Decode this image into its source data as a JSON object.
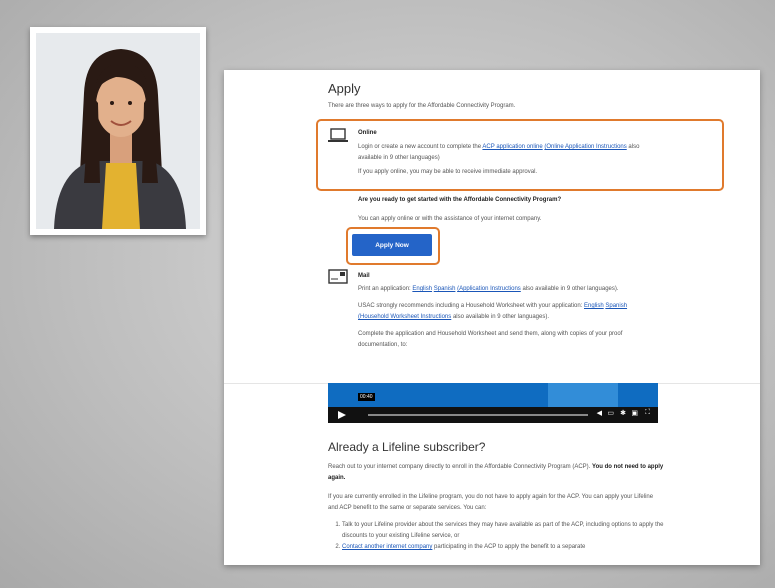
{
  "apply": {
    "title": "Apply",
    "intro": "There are three ways to apply for the Affordable Connectivity Program.",
    "online": {
      "heading": "Online",
      "line1_pre": "Login or create a new account to complete the ",
      "line1_link": "ACP application online",
      "line1_link2": "(Online Application Instructions",
      "line1_post": " also available in 9 other languages)",
      "line2": "If you apply online, you may be able to receive immediate approval."
    },
    "ready_heading": "Are you ready to get started with the Affordable Connectivity Program?",
    "ready_text": "You can apply online or with the assistance of your internet company.",
    "apply_button": "Apply Now",
    "mail": {
      "heading": "Mail",
      "p1_pre": "Print an application: ",
      "p1_english": "English",
      "p1_spanish": "Spanish",
      "p1_instr": "(Application Instructions",
      "p1_post": " also available in 9 other languages).",
      "p2_pre": "USAC strongly recommends including a Household Worksheet with your application: ",
      "p2_english": "English",
      "p2_spanish": "Spanish",
      "p2_instr": "(Household Worksheet Instructions",
      "p2_post": " also available in 9 other languages).",
      "p3": "Complete the application and Household Worksheet and send them, along with copies of your proof documentation, to:"
    }
  },
  "video": {
    "time": "00:40"
  },
  "lifeline": {
    "title": "Already a Lifeline subscriber?",
    "p1_pre": "Reach out to your internet company directly to enroll in the Affordable Connectivity Program (ACP). ",
    "p1_bold": "You do not need to apply again.",
    "p2": "If you are currently enrolled in the Lifeline program, you do not have to apply again for the ACP. You can apply your Lifeline and ACP benefit to the same or separate services. You can:",
    "item1": "Talk to your Lifeline provider about the services they may have available as part of the ACP, including options to apply the discounts to your existing Lifeline service, or",
    "item2_link": "Contact another internet company",
    "item2_post": " participating in the ACP to apply the benefit to a separate"
  },
  "colors": {
    "highlight": "#e07a2d",
    "button": "#2464c8",
    "link": "#1a56b8"
  }
}
